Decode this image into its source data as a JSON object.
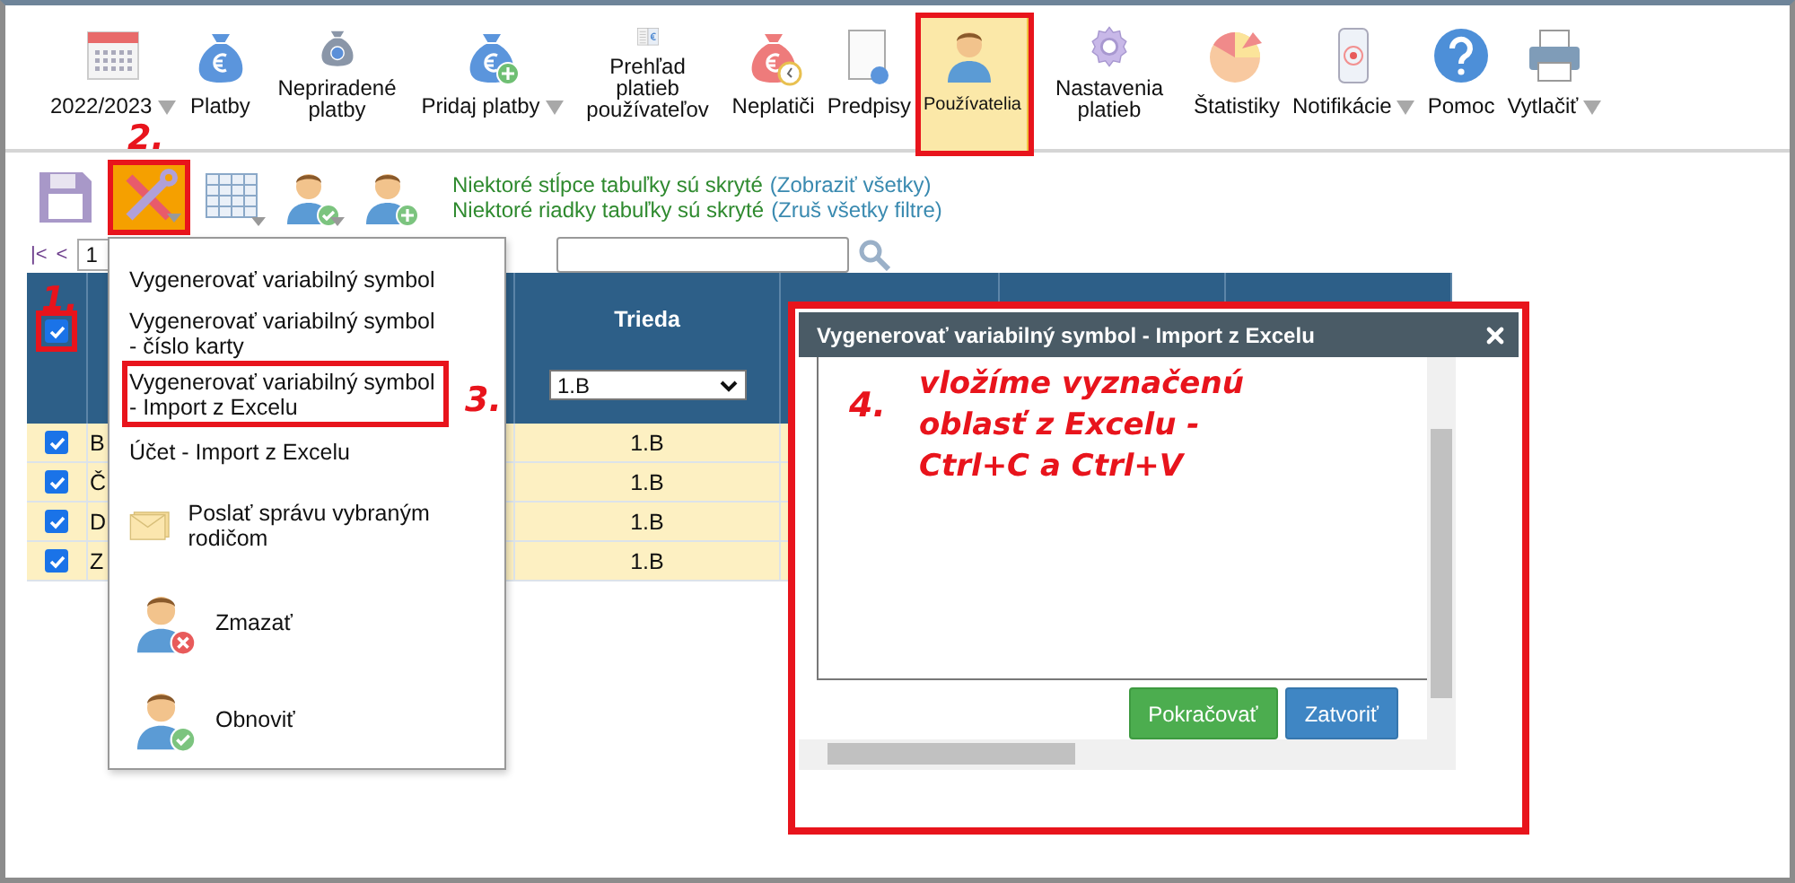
{
  "toolbar": {
    "items": [
      {
        "label": "2022/2023",
        "dropdown": true,
        "selected": false,
        "annotated": false
      },
      {
        "label": "Platby",
        "dropdown": false,
        "selected": false,
        "annotated": false
      },
      {
        "label": "Nepriradené platby",
        "dropdown": false,
        "selected": false,
        "annotated": false
      },
      {
        "label": "Pridaj platby",
        "dropdown": true,
        "selected": false,
        "annotated": false
      },
      {
        "label": "Prehľad platieb používateľov",
        "dropdown": false,
        "selected": false,
        "annotated": false
      },
      {
        "label": "Neplatiči",
        "dropdown": false,
        "selected": false,
        "annotated": false
      },
      {
        "label": "Predpisy",
        "dropdown": false,
        "selected": false,
        "annotated": false
      },
      {
        "label": "Používatelia",
        "dropdown": false,
        "selected": true,
        "annotated": true
      },
      {
        "label": "Nastavenia platieb",
        "dropdown": false,
        "selected": false,
        "annotated": false
      },
      {
        "label": "Štatistiky",
        "dropdown": false,
        "selected": false,
        "annotated": false
      },
      {
        "label": "Notifikácie",
        "dropdown": true,
        "selected": false,
        "annotated": false
      },
      {
        "label": "Pomoc",
        "dropdown": false,
        "selected": false,
        "annotated": false
      },
      {
        "label": "Vytlačiť",
        "dropdown": true,
        "selected": false,
        "annotated": false
      }
    ]
  },
  "actions": {
    "tools": {
      "selected": true,
      "annotated": true
    },
    "notices": [
      {
        "text": "Niektoré stĺpce tabuľky sú skryté",
        "link": "(Zobraziť všetky)"
      },
      {
        "text": "Niektoré riadky tabuľky sú skryté",
        "link": "(Zruš všetky filtre)"
      }
    ]
  },
  "pagination": {
    "first": "|<",
    "prev": "<",
    "page": "1"
  },
  "table": {
    "header_checkbox": {
      "checked": true,
      "annotated": true
    },
    "columns": [
      {
        "label": "Trieda",
        "filter": "1.B"
      }
    ],
    "rows": [
      {
        "checked": true,
        "column_2": "B",
        "trieda": "1.B"
      },
      {
        "checked": true,
        "column_2": "Č",
        "trieda": "1.B"
      },
      {
        "checked": true,
        "column_2": "D",
        "trieda": "1.B"
      },
      {
        "checked": true,
        "column_2": "Z",
        "trieda": "1.B"
      }
    ]
  },
  "menu": {
    "items": [
      {
        "kind": "plain",
        "label": "Vygenerovať variabilný symbol",
        "annotated": false
      },
      {
        "kind": "plain",
        "label": "Vygenerovať variabilný symbol - číslo karty",
        "annotated": false
      },
      {
        "kind": "plain",
        "label": "Vygenerovať variabilný symbol - Import z Excelu",
        "annotated": true
      },
      {
        "kind": "plain",
        "label": "Účet - Import z Excelu",
        "annotated": false
      },
      {
        "kind": "mail",
        "label": "Poslať správu vybraným rodičom",
        "annotated": false
      },
      {
        "kind": "remove",
        "label": "Zmazať",
        "annotated": false
      },
      {
        "kind": "restore",
        "label": "Obnoviť",
        "annotated": false
      }
    ]
  },
  "dialog": {
    "title": "Vygenerovať variabilný symbol - Import z Excelu",
    "annotated": true,
    "note": "vložíme vyznačenú oblasť z Excelu - Ctrl+C a Ctrl+V",
    "buttons": [
      {
        "kind": "primary",
        "label": "Pokračovať"
      },
      {
        "kind": "secondary",
        "label": "Zatvoriť"
      }
    ]
  },
  "annotations": [
    "1.",
    "2.",
    "3.",
    "4."
  ]
}
